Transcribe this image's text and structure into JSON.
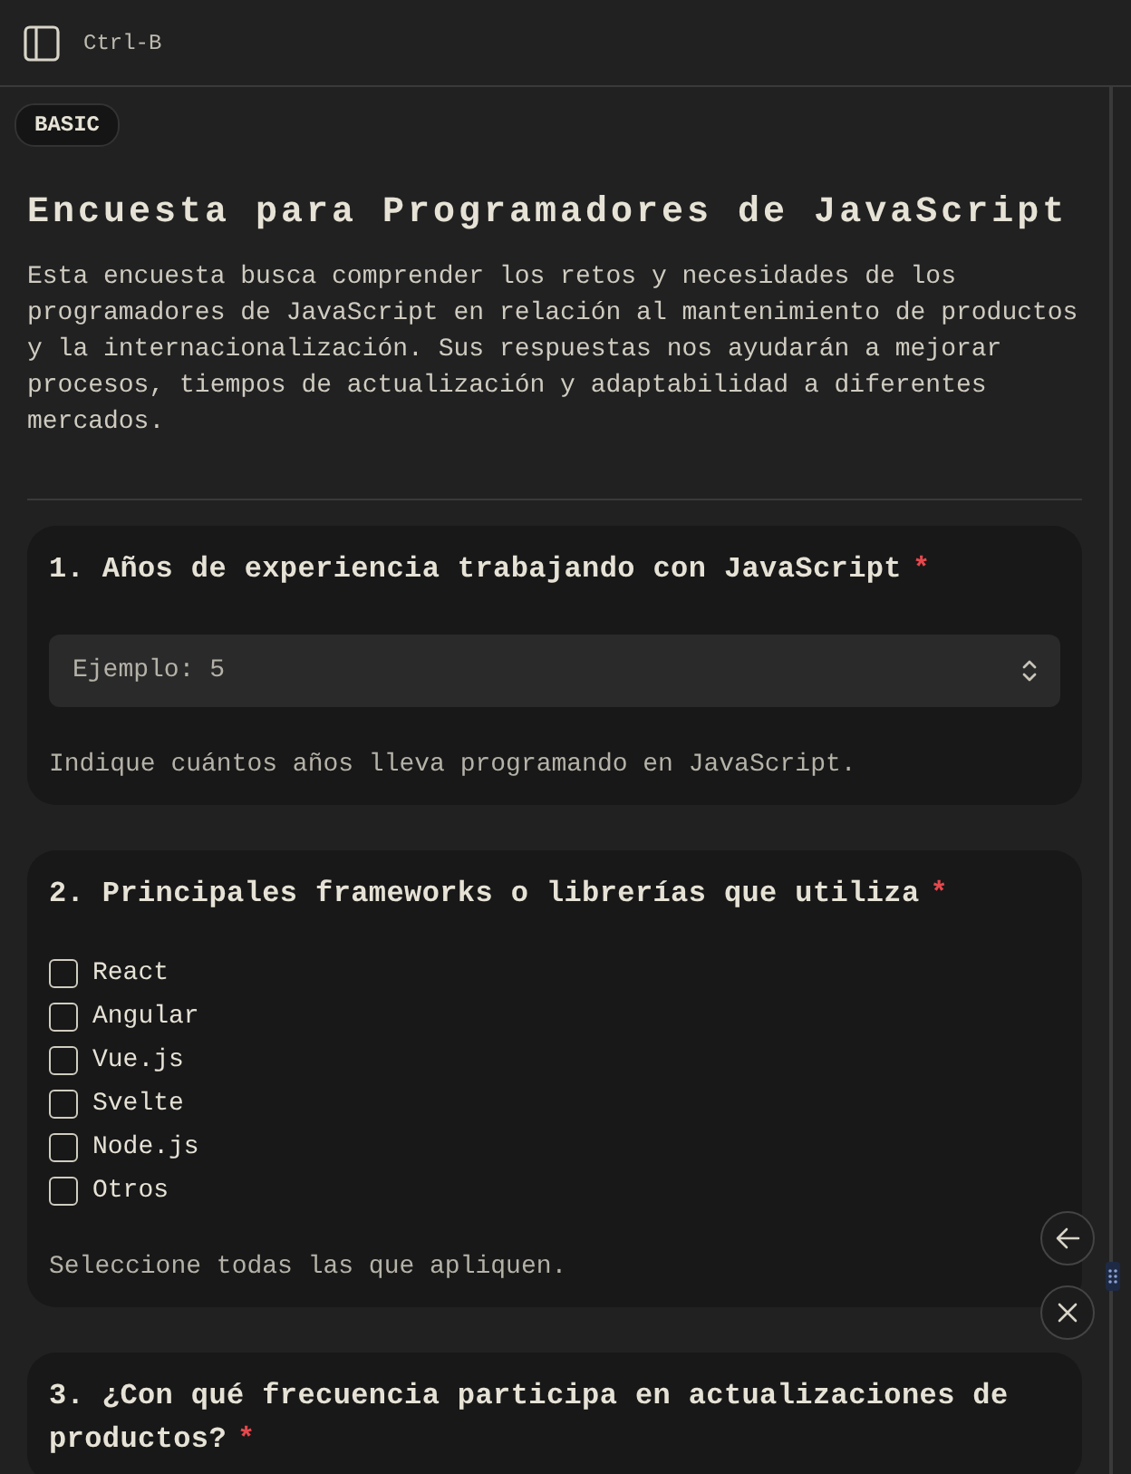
{
  "header": {
    "shortcut": "Ctrl-B"
  },
  "badge": "BASIC",
  "title": "Encuesta para Programadores de JavaScript",
  "description": "Esta encuesta busca comprender los retos y necesidades de los programadores de JavaScript en relación al mantenimiento de productos y la internacionalización. Sus respuestas nos ayudarán a mejorar procesos, tiempos de actualización y adaptabilidad a diferentes mercados.",
  "questions": [
    {
      "kind": "number",
      "title": "1. Años de experiencia trabajando con JavaScript",
      "required_mark": "*",
      "placeholder": "Ejemplo: 5",
      "help": "Indique cuántos años lleva programando en JavaScript."
    },
    {
      "kind": "checkboxes",
      "title": "2. Principales frameworks o librerías que utiliza",
      "required_mark": "*",
      "options": [
        {
          "label": "React",
          "checked": false
        },
        {
          "label": "Angular",
          "checked": false
        },
        {
          "label": "Vue.js",
          "checked": false
        },
        {
          "label": "Svelte",
          "checked": false
        },
        {
          "label": "Node.js",
          "checked": false
        },
        {
          "label": "Otros",
          "checked": false
        }
      ],
      "help": "Seleccione todas las que apliquen."
    },
    {
      "kind": "heading",
      "title": "3. ¿Con qué frecuencia participa en actualizaciones de productos?",
      "required_mark": "*"
    }
  ]
}
